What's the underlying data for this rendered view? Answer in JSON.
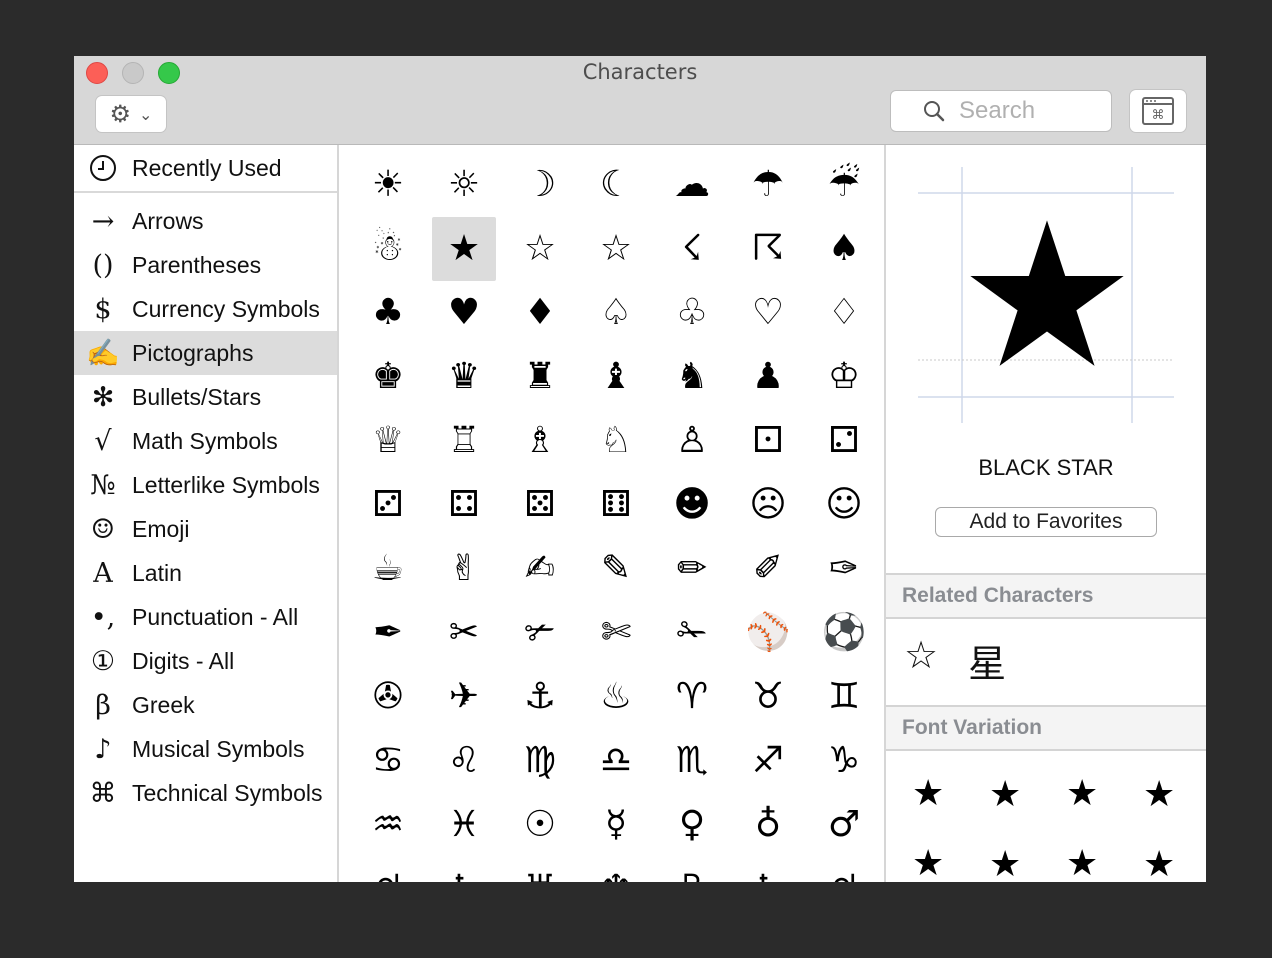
{
  "window": {
    "title": "Characters",
    "search_placeholder": "Search"
  },
  "sidebar": {
    "recent": {
      "label": "Recently Used",
      "icon": "clock-icon"
    },
    "items": [
      {
        "icon": "→",
        "label": "Arrows",
        "name": "arrows"
      },
      {
        "icon": "()",
        "label": "Parentheses",
        "name": "parentheses"
      },
      {
        "icon": "$",
        "label": "Currency Symbols",
        "name": "currency-symbols"
      },
      {
        "icon": "✍",
        "label": "Pictographs",
        "name": "pictographs"
      },
      {
        "icon": "✻",
        "label": "Bullets/Stars",
        "name": "bullets-stars"
      },
      {
        "icon": "√",
        "label": "Math Symbols",
        "name": "math-symbols"
      },
      {
        "icon": "№",
        "label": "Letterlike Symbols",
        "name": "letterlike-symbols"
      },
      {
        "icon": "☺",
        "label": "Emoji",
        "name": "emoji"
      },
      {
        "icon": "A",
        "label": "Latin",
        "name": "latin"
      },
      {
        "icon": "•,",
        "label": "Punctuation - All",
        "name": "punctuation-all"
      },
      {
        "icon": "①",
        "label": "Digits - All",
        "name": "digits-all"
      },
      {
        "icon": "β",
        "label": "Greek",
        "name": "greek"
      },
      {
        "icon": "♪",
        "label": "Musical Symbols",
        "name": "musical-symbols"
      },
      {
        "icon": "⌘",
        "label": "Technical Symbols",
        "name": "technical-symbols"
      }
    ],
    "selected": "Pictographs"
  },
  "grid": {
    "characters": [
      [
        "☀",
        "☼",
        "☽",
        "☾",
        "☁",
        "☂",
        "☔"
      ],
      [
        "☃",
        "★",
        "☆",
        "☆",
        "☇",
        "☈",
        "♠"
      ],
      [
        "♣",
        "♥",
        "♦",
        "♤",
        "♧",
        "♡",
        "♢"
      ],
      [
        "♚",
        "♛",
        "♜",
        "♝",
        "♞",
        "♟",
        "♔"
      ],
      [
        "♕",
        "♖",
        "♗",
        "♘",
        "♙",
        "⚀",
        "⚁"
      ],
      [
        "⚂",
        "⚃",
        "⚄",
        "⚅",
        "☻",
        "☹",
        "☺"
      ],
      [
        "☕",
        "✌",
        "✍",
        "✎",
        "✏",
        "✐",
        "✑"
      ],
      [
        "✒",
        "✂",
        "✃",
        "✄",
        "✁",
        "⚾",
        "⚽"
      ],
      [
        "✇",
        "✈",
        "⚓",
        "♨",
        "♈",
        "♉",
        "♊"
      ],
      [
        "♋",
        "♌",
        "♍",
        "♎",
        "♏",
        "♐",
        "♑"
      ],
      [
        "♒",
        "♓",
        "☉",
        "☿",
        "♀",
        "♁",
        "♂"
      ],
      [
        "♃",
        "♄",
        "♅",
        "♆",
        "♇",
        "♄",
        "♃"
      ]
    ],
    "selected": "★"
  },
  "detail": {
    "character": "★",
    "name": "BLACK STAR",
    "favorites_label": "Add to Favorites",
    "related_header": "Related Characters",
    "related": [
      "☆",
      "星"
    ],
    "variation_header": "Font Variation",
    "variations": [
      "★",
      "★",
      "★",
      "★",
      "★",
      "★",
      "★",
      "★"
    ]
  },
  "colors": {
    "titlebar": "#d7d7d7",
    "close": "#fc5f57",
    "minimize": "#c9c9c9",
    "maximize": "#35c84a",
    "selection": "#dcdcdc",
    "section_header_text": "#8a8d92"
  }
}
